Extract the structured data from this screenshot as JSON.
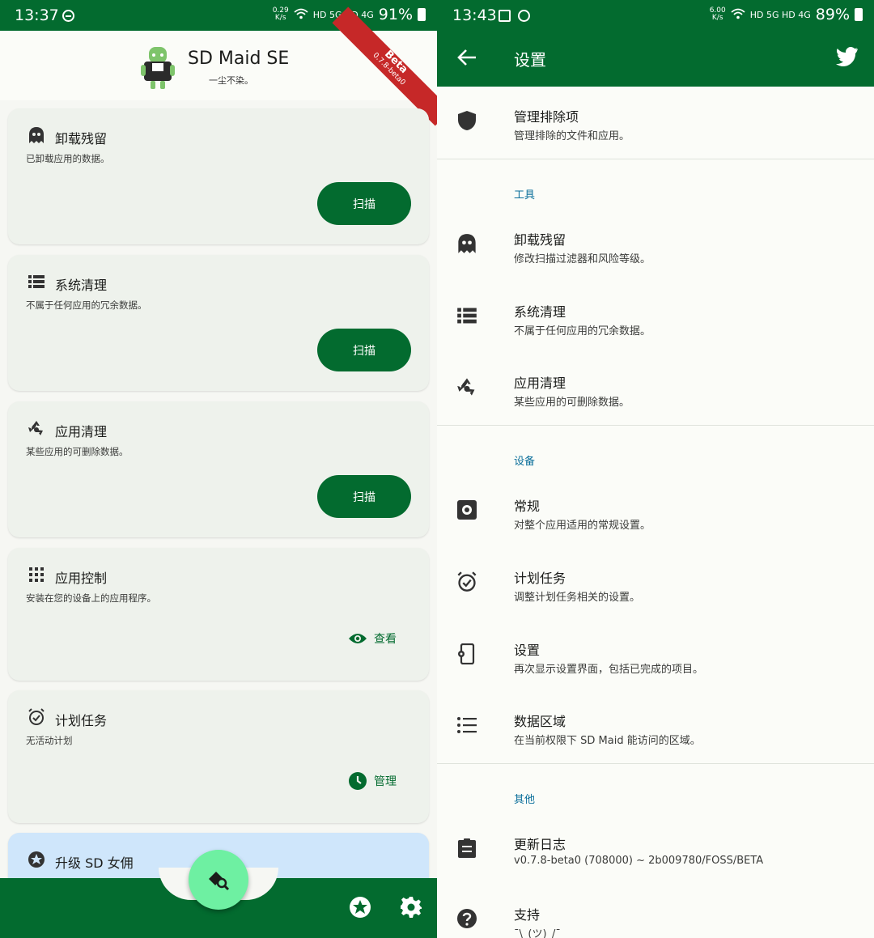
{
  "left": {
    "status": {
      "time": "13:37",
      "speed_top": "0.29",
      "speed_bottom": "K/s",
      "net": "HD 5G HD 4G",
      "battery": "91%"
    },
    "header": {
      "title": "SD Maid SE",
      "subtitle": "一尘不染。",
      "beta_label": "Beta",
      "beta_version": "0.7.8-beta0"
    },
    "cards": [
      {
        "title": "卸载残留",
        "desc": "已卸载应用的数据。",
        "action": "扫描"
      },
      {
        "title": "系统清理",
        "desc": "不属于任何应用的冗余数据。",
        "action": "扫描"
      },
      {
        "title": "应用清理",
        "desc": "某些应用的可删除数据。",
        "action": "扫描"
      },
      {
        "title": "应用控制",
        "desc": "安装在您的设备上的应用程序。",
        "action": "查看"
      },
      {
        "title": "计划任务",
        "desc": "无活动计划",
        "action": "管理"
      },
      {
        "title": "升级 SD 女佣"
      }
    ]
  },
  "right": {
    "status": {
      "time": "13:43",
      "speed_top": "6.00",
      "speed_bottom": "K/s",
      "net": "HD 5G HD 4G",
      "battery": "89%"
    },
    "topbar": {
      "title": "设置"
    },
    "exclusions": {
      "title": "管理排除项",
      "desc": "管理排除的文件和应用。"
    },
    "sections": {
      "tools": "工具",
      "device": "设备",
      "other": "其他"
    },
    "tools": [
      {
        "title": "卸载残留",
        "desc": "修改扫描过滤器和风险等级。"
      },
      {
        "title": "系统清理",
        "desc": "不属于任何应用的冗余数据。"
      },
      {
        "title": "应用清理",
        "desc": "某些应用的可删除数据。"
      }
    ],
    "device": [
      {
        "title": "常规",
        "desc": "对整个应用适用的常规设置。"
      },
      {
        "title": "计划任务",
        "desc": "调整计划任务相关的设置。"
      },
      {
        "title": "设置",
        "desc": "再次显示设置界面，包括已完成的项目。"
      },
      {
        "title": "数据区域",
        "desc": "在当前权限下 SD Maid 能访问的区域。"
      }
    ],
    "other": [
      {
        "title": "更新日志",
        "desc": "v0.7.8-beta0 (708000) ~ 2b009780/FOSS/BETA"
      },
      {
        "title": "支持",
        "desc": "¯\\_(ツ)_/¯"
      }
    ]
  },
  "colors": {
    "primary": "#036b2f",
    "fab": "#6ef0a2",
    "card": "#eef2ec",
    "upgrade_card": "#cfe6fb",
    "section": "#0a6e9a",
    "beta_ribbon": "#c62828"
  }
}
